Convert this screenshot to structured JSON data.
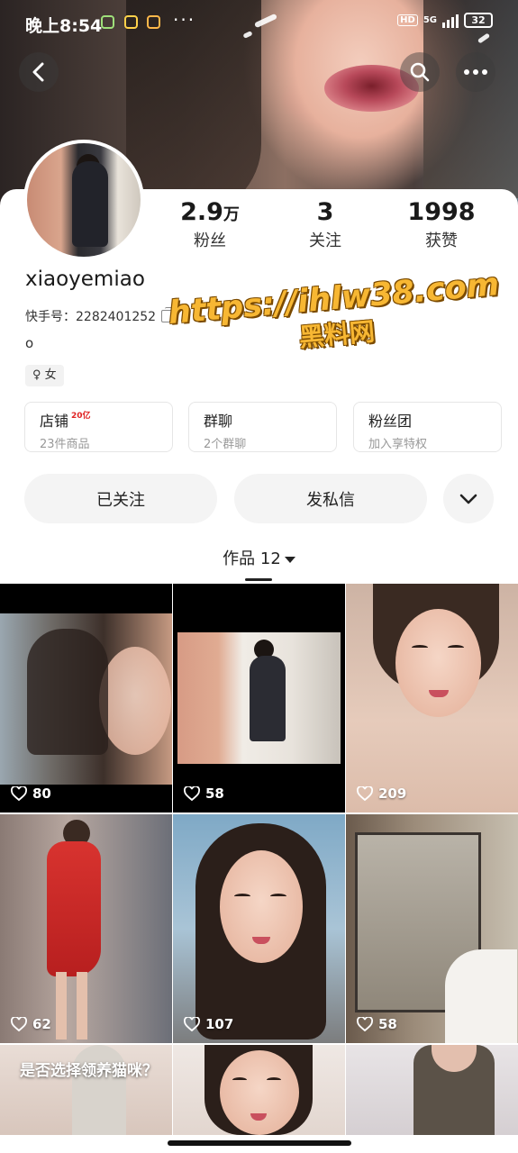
{
  "status_bar": {
    "time": "晚上8:54",
    "dots": "···",
    "hd": "HD",
    "network": "5G",
    "battery": "32"
  },
  "profile": {
    "followers_value": "2.9",
    "followers_unit": "万",
    "followers_label": "粉丝",
    "following_value": "3",
    "following_label": "关注",
    "likes_value": "1998",
    "likes_label": "获赞",
    "username": "xiaoyemiao",
    "id_line": "快手号：2282401252",
    "bio": "o",
    "gender": "♀ 女"
  },
  "watermark": {
    "url": "https://ihlw38.com",
    "name": "黑料网"
  },
  "features": [
    {
      "title": "店铺",
      "badge": "20亿",
      "sub": "23件商品"
    },
    {
      "title": "群聊",
      "sub": "2个群聊"
    },
    {
      "title": "粉丝团",
      "sub": "加入享特权"
    }
  ],
  "actions": {
    "followed_label": "已关注",
    "message_label": "发私信"
  },
  "works_tab": {
    "label": "作品 12"
  },
  "tiles": [
    {
      "likes": "80"
    },
    {
      "likes": "58"
    },
    {
      "likes": "209"
    },
    {
      "likes": "62"
    },
    {
      "likes": "107"
    },
    {
      "likes": "58"
    },
    {
      "caption": "是否选择领养猫咪？"
    },
    {},
    {}
  ],
  "colors": {
    "watermark": "#f7b733",
    "text_primary": "#222222",
    "text_secondary": "#999999",
    "button_bg": "#f4f4f4"
  }
}
